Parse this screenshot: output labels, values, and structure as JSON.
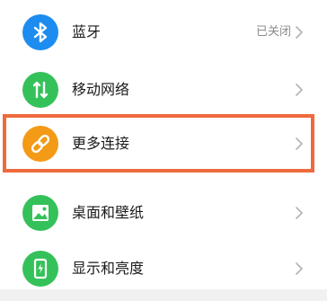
{
  "settings": {
    "items": [
      {
        "label": "蓝牙",
        "value": "已关闭",
        "icon": "bluetooth-icon",
        "icon_color": "#1d8cf0"
      },
      {
        "label": "移动网络",
        "icon": "mobile-data-icon",
        "icon_color": "#35c15a"
      },
      {
        "label": "更多连接",
        "icon": "link-icon",
        "icon_color": "#f39a16"
      },
      {
        "label": "桌面和壁纸",
        "icon": "wallpaper-icon",
        "icon_color": "#35c15a"
      },
      {
        "label": "显示和亮度",
        "icon": "display-brightness-icon",
        "icon_color": "#35c15a"
      }
    ]
  },
  "colors": {
    "highlight_border": "#ee6a3d",
    "background": "#f1f1f1",
    "chevron": "#b3b3b3"
  }
}
